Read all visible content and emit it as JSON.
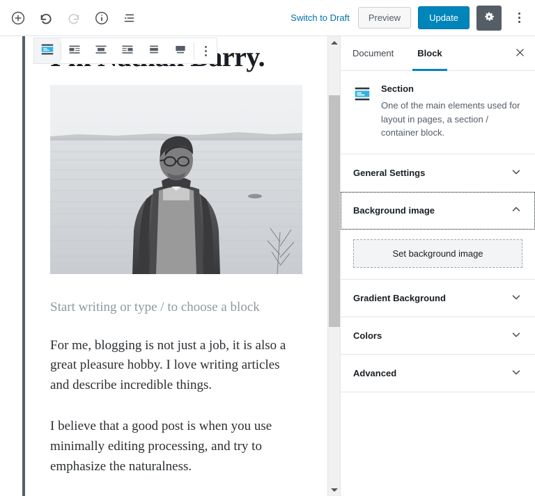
{
  "topbar": {
    "left_tools": [
      {
        "name": "add-block-button",
        "icon": "plus-circle-icon",
        "label": "Add block",
        "disabled": false
      },
      {
        "name": "undo-button",
        "icon": "undo-icon",
        "label": "Undo",
        "disabled": false
      },
      {
        "name": "redo-button",
        "icon": "redo-icon",
        "label": "Redo",
        "disabled": true
      },
      {
        "name": "content-info-button",
        "icon": "info-circle-icon",
        "label": "Content structure",
        "disabled": false
      },
      {
        "name": "block-navigation-button",
        "icon": "list-view-icon",
        "label": "Block navigation",
        "disabled": false
      }
    ],
    "switch_to_draft": "Switch to Draft",
    "preview": "Preview",
    "update": "Update",
    "settings_icon": "gear-icon",
    "more_icon": "kebab-menu-icon"
  },
  "block_toolbar": {
    "items": [
      {
        "name": "block-type-section-button",
        "icon": "section-block-icon",
        "label": "Section",
        "active": true
      },
      {
        "name": "align-media-left-button",
        "icon": "align-media-left-icon",
        "label": "Align left"
      },
      {
        "name": "align-media-center-button",
        "icon": "align-media-center-icon",
        "label": "Align center"
      },
      {
        "name": "align-media-right-button",
        "icon": "align-media-right-icon",
        "label": "Align right"
      },
      {
        "name": "align-wide-button",
        "icon": "align-wide-icon",
        "label": "Wide width"
      },
      {
        "name": "align-full-button",
        "icon": "align-full-icon",
        "label": "Full width"
      }
    ],
    "more_options_label": "More options",
    "more_options_icon": "kebab-menu-icon"
  },
  "editor": {
    "post_title": "I'm Nathan Barry.",
    "image_alt": "Man in dark parka and glasses standing by a foggy lake, black and white",
    "placeholder": "Start writing or type / to choose a block",
    "paragraphs": [
      "For me, blogging is not just a job, it is also a great pleasure hobby. I love writing articles and describe incredible things.",
      " I believe that a good post is when you use minimally editing processing, and try to emphasize the naturalness."
    ],
    "scrollbar": {
      "up_arrow_icon": "triangle-up-icon",
      "down_arrow_icon": "triangle-down-icon"
    }
  },
  "sidebar": {
    "tabs": [
      {
        "name": "tab-document",
        "label": "Document",
        "active": false
      },
      {
        "name": "tab-block",
        "label": "Block",
        "active": true
      }
    ],
    "close_icon": "close-icon",
    "block_card": {
      "icon": "section-block-icon",
      "title": "Section",
      "description": "One of the main elements used for layout in pages, a section / container block."
    },
    "panels": [
      {
        "name": "panel-general-settings",
        "label": "General Settings",
        "open": false,
        "focused": false,
        "chevron": "chevron-down-icon"
      },
      {
        "name": "panel-background-image",
        "label": "Background image",
        "open": true,
        "focused": true,
        "chevron": "chevron-up-icon",
        "button_label": "Set background image"
      },
      {
        "name": "panel-gradient-background",
        "label": "Gradient Background",
        "open": false,
        "focused": false,
        "chevron": "chevron-down-icon"
      },
      {
        "name": "panel-colors",
        "label": "Colors",
        "open": false,
        "focused": false,
        "chevron": "chevron-down-icon"
      },
      {
        "name": "panel-advanced",
        "label": "Advanced",
        "open": false,
        "focused": false,
        "chevron": "chevron-down-icon"
      }
    ]
  },
  "colors": {
    "accent_blue": "#0085ba",
    "link_blue": "#0073aa",
    "gear_bg": "#555d66",
    "border": "#e2e4e7",
    "block_highlight": "#f6f6fb",
    "text_dark": "#191e23",
    "text_muted": "#555d66",
    "placeholder_gray": "#8f98a1"
  }
}
